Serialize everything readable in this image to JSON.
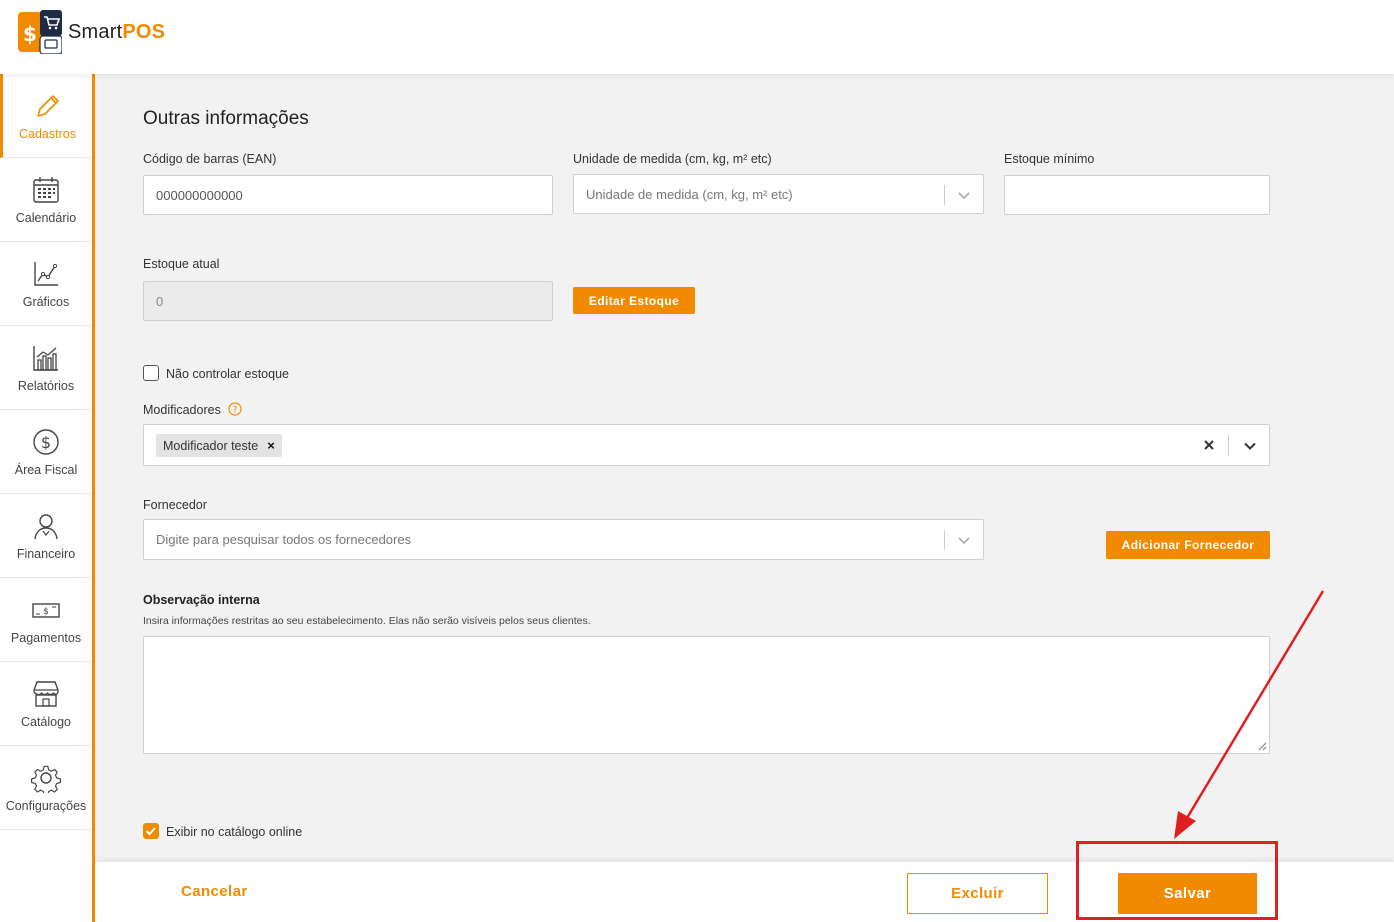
{
  "app": {
    "logo_text_light": "Smart",
    "logo_text_bold": "POS"
  },
  "sidebar": {
    "items": [
      {
        "label": "Cadastros",
        "icon": "pencil-icon",
        "active": true
      },
      {
        "label": "Calendário",
        "icon": "calendar-icon"
      },
      {
        "label": "Gráficos",
        "icon": "line-chart-icon"
      },
      {
        "label": "Relatórios",
        "icon": "bar-chart-icon"
      },
      {
        "label": "Área Fiscal",
        "icon": "dollar-circle-icon"
      },
      {
        "label": "Financeiro",
        "icon": "person-icon"
      },
      {
        "label": "Pagamentos",
        "icon": "banknote-icon"
      },
      {
        "label": "Catálogo",
        "icon": "store-icon"
      },
      {
        "label": "Configurações",
        "icon": "gear-icon"
      }
    ]
  },
  "form": {
    "title": "Outras informações",
    "barcode": {
      "label": "Código de barras (EAN)",
      "value": "000000000000"
    },
    "unit": {
      "label": "Unidade de medida (cm, kg, m² etc)",
      "placeholder": "Unidade de medida (cm, kg, m² etc)"
    },
    "min_stock": {
      "label": "Estoque mínimo",
      "value": ""
    },
    "current_stock": {
      "label": "Estoque atual",
      "value": "0"
    },
    "edit_stock_button": "Editar Estoque",
    "no_stock_control": {
      "label": "Não controlar estoque",
      "checked": false
    },
    "modifiers": {
      "label": "Modificadores",
      "tags": [
        "Modificador teste"
      ]
    },
    "supplier": {
      "label": "Fornecedor",
      "placeholder": "Digite para pesquisar todos os fornecedores"
    },
    "add_supplier_button": "Adicionar Fornecedor",
    "internal_note": {
      "label": "Observação interna",
      "help": "Insira informações restritas ao seu estabelecimento. Elas não serão visíveis pelos seus clientes.",
      "value": ""
    },
    "show_online_catalog": {
      "label": "Exibir no catálogo online",
      "checked": true
    }
  },
  "footer": {
    "cancel": "Cancelar",
    "delete": "Excluir",
    "save": "Salvar"
  },
  "colors": {
    "accent": "#f28a00",
    "annotation": "#e02020"
  }
}
